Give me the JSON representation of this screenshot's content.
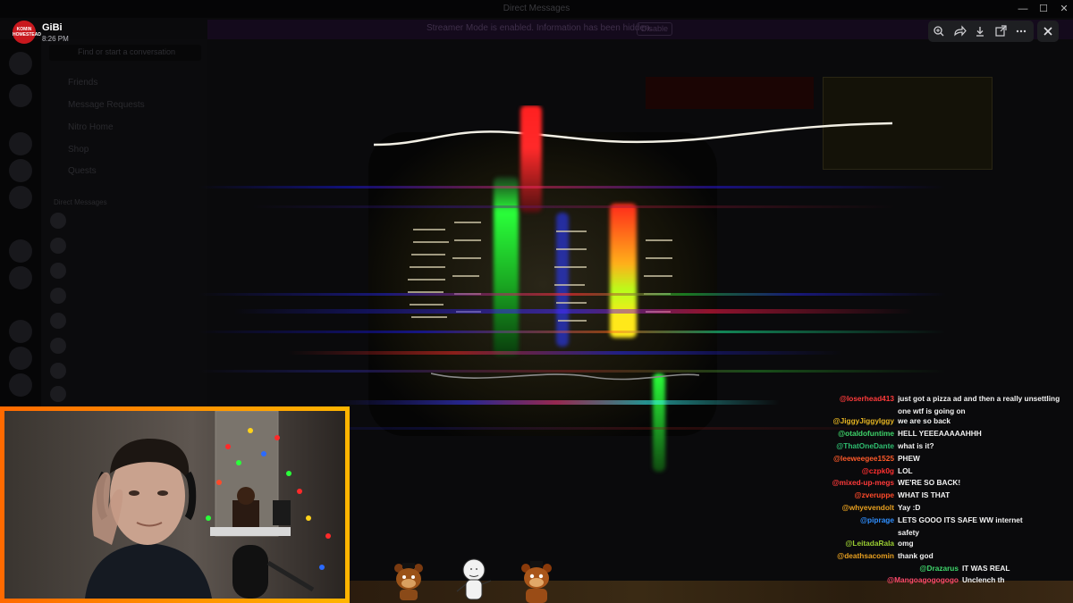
{
  "window": {
    "title": "Direct Messages",
    "controls": [
      "—",
      "☐",
      "✕"
    ]
  },
  "banner": {
    "text": "Streamer Mode is enabled. Information has been hidden.",
    "button_label": "Disable"
  },
  "sidebar": {
    "search_placeholder": "Find or start a conversation",
    "nav": [
      "Friends",
      "Message Requests",
      "Nitro Home",
      "Shop",
      "Quests"
    ],
    "section_label": "Direct Messages"
  },
  "viewer": {
    "author_name": "GiBi",
    "author_avatar_text": "KOMIN HOMESTEAD",
    "timestamp": "8:26 PM",
    "toolbar_icons": [
      "zoom-icon",
      "forward-icon",
      "download-icon",
      "open-external-icon",
      "more-icon"
    ],
    "close_icon": "close-icon"
  },
  "chat": {
    "messages": [
      {
        "user": "@loserhead413",
        "color": "#ff3b3b",
        "text": "just got a pizza ad and then a really unsettling one wtf is going on"
      },
      {
        "user": "@JiggyJiggyIggy",
        "color": "#e6b422",
        "text": "we are so back"
      },
      {
        "user": "@otaldofuntime",
        "color": "#3fd56b",
        "text": "HELL YEEEAAAAAHHH"
      },
      {
        "user": "@ThatOneDante",
        "color": "#2fbf71",
        "text": "what is it?"
      },
      {
        "user": "@leeweegee1525",
        "color": "#ff5a2a",
        "text": "PHEW"
      },
      {
        "user": "@czpk0g",
        "color": "#ff3030",
        "text": "LOL"
      },
      {
        "user": "@mixed-up-megs",
        "color": "#ff3a3a",
        "text": "WE'RE SO BACK!"
      },
      {
        "user": "@zveruppe",
        "color": "#ff4a2a",
        "text": "WHAT IS THAT"
      },
      {
        "user": "@whyevendolt",
        "color": "#e8a020",
        "text": "Yay :D"
      },
      {
        "user": "@piprage",
        "color": "#2f8fff",
        "text": "LETS GOOO ITS SAFE WW internet safety"
      },
      {
        "user": "@LeitadaRala",
        "color": "#9acd32",
        "text": "omg"
      },
      {
        "user": "@deathsacomin",
        "color": "#e8a020",
        "text": "thank god"
      },
      {
        "user": "@Drazarus",
        "color": "#3fd56b",
        "text": "IT WAS REAL"
      },
      {
        "user": "@Mangoagogogogo",
        "color": "#ff4a6a",
        "text": "Unclench th"
      }
    ]
  },
  "stickers": [
    "freddy-sticker",
    "dancing-bean-sticker",
    "freddy-plush-sticker"
  ],
  "colors": {
    "toolbar_bg": "#1e1f22",
    "webcam_border": "#ff8a00"
  }
}
